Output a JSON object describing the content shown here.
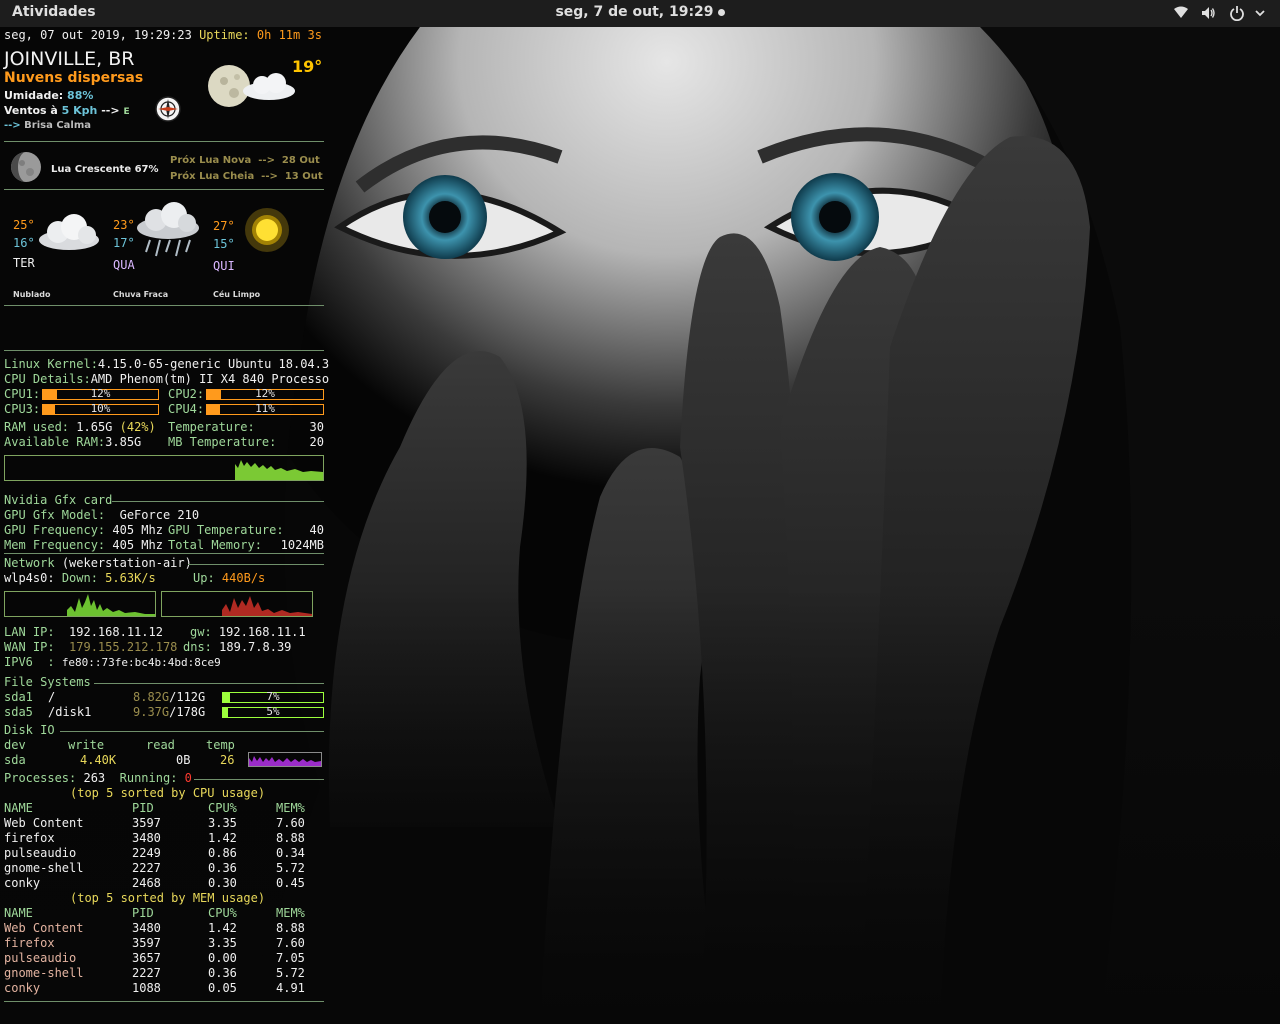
{
  "topbar": {
    "activities": "Atividades",
    "clock": "seg,  7 de out, 19:29",
    "icons": [
      "wifi-icon",
      "volume-icon",
      "power-icon",
      "chevron-down-icon"
    ]
  },
  "weather": {
    "datetime": "seg, 07 out 2019, 19:29:23",
    "uptime_label": "Uptime:",
    "uptime_value": "0h 11m 3s",
    "city": "JOINVILLE, BR",
    "condition": "Nuvens dispersas",
    "humidity_label": "Umidade:",
    "humidity_value": "88%",
    "wind_label": "Ventos à",
    "wind_value": "5 Kph",
    "wind_arrow": "-->",
    "wind_dir": "E",
    "breeze_arrow": "-->",
    "breeze": "Brisa Calma",
    "temp": "19°",
    "moon": "Lua Crescente 67%",
    "next_new_label": "Próx Lua Nova",
    "next_new_arrow": "-->",
    "next_new_date": "28 Out",
    "next_full_label": "Próx Lua Cheia",
    "next_full_arrow": "-->",
    "next_full_date": "13 Out",
    "forecast": [
      {
        "high": "25°",
        "low": "16°",
        "day": "TER",
        "desc": "Nublado",
        "icon": "cloudy-icon"
      },
      {
        "high": "23°",
        "low": "17°",
        "day": "QUA",
        "desc": "Chuva Fraca",
        "icon": "rain-icon"
      },
      {
        "high": "27°",
        "low": "15°",
        "day": "QUI",
        "desc": "Céu Limpo",
        "icon": "sun-icon"
      }
    ]
  },
  "system": {
    "kernel_label": "Linux Kernel:",
    "kernel_value": "4.15.0-65-generic Ubuntu 18.04.3",
    "cpu_label": "CPU Details:",
    "cpu_value": "AMD Phenom(tm) II X4 840 Processo",
    "cpus": [
      {
        "label": "CPU1:",
        "value": "12%",
        "pct": 12
      },
      {
        "label": "CPU2:",
        "value": "12%",
        "pct": 12
      },
      {
        "label": "CPU3:",
        "value": "10%",
        "pct": 10
      },
      {
        "label": "CPU4:",
        "value": "11%",
        "pct": 11
      }
    ],
    "ram_used_label": "RAM used:",
    "ram_used_value": "1.65G",
    "ram_used_pct": "(42%)",
    "ram_avail_label": "Available RAM:",
    "ram_avail_value": "3.85G",
    "temp_label": "Temperature:",
    "temp_value": "30",
    "mbtemp_label": "MB Temperature:",
    "mbtemp_value": "20"
  },
  "gpu": {
    "header": "Nvidia Gfx card",
    "model_label": "GPU Gfx Model:",
    "model_value": "GeForce 210",
    "freq_label": "GPU Frequency:",
    "freq_value": "405 Mhz",
    "gtemp_label": "GPU Temperature:",
    "gtemp_value": "40",
    "mem_label": "Mem Frequency:",
    "mem_value": "405 Mhz",
    "tmem_label": "Total Memory:",
    "tmem_value": "1024MB"
  },
  "network": {
    "header": "Network",
    "host": "(wekerstation-air)",
    "iface": "wlp4s0:",
    "down_label": "Down:",
    "down_value": "5.63K/s",
    "up_label": "Up:",
    "up_value": "440B/s",
    "lan_label": "LAN IP:",
    "lan_value": "192.168.11.12",
    "gw_label": "gw:",
    "gw_value": "192.168.11.1",
    "wan_label": "WAN IP:",
    "wan_value": "179.155.212.178",
    "dns_label": "dns:",
    "dns_value": "189.7.8.39",
    "ipv6_label": "IPV6  :",
    "ipv6_value": "fe80::73fe:bc4b:4bd:8ce9"
  },
  "fs": {
    "header": "File Systems",
    "items": [
      {
        "dev": "sda1",
        "mount": "/",
        "size": "8.82G",
        "total": "/112G",
        "pct_label": "7%",
        "pct": 7
      },
      {
        "dev": "sda5",
        "mount": "/disk1",
        "size": "9.37G",
        "total": "/178G",
        "pct_label": "5%",
        "pct": 5
      }
    ]
  },
  "diskio": {
    "header": "Disk IO",
    "cols": [
      "dev",
      "write",
      "read",
      "temp"
    ],
    "dev": "sda",
    "write": "4.40K",
    "read": "0B",
    "temp": "26"
  },
  "processes": {
    "label": "Processes:",
    "count": "263",
    "running_label": "Running:",
    "running": "0",
    "cpu_title": "(top 5 sorted by CPU usage)",
    "mem_title": "(top 5 sorted by MEM usage)",
    "cols": [
      "NAME",
      "PID",
      "CPU%",
      "MEM%"
    ],
    "cpu_rows": [
      [
        "Web Content",
        "3597",
        "3.35",
        "7.60"
      ],
      [
        "firefox",
        "3480",
        "1.42",
        "8.88"
      ],
      [
        "pulseaudio",
        "2249",
        "0.86",
        "0.34"
      ],
      [
        "gnome-shell",
        "2227",
        "0.36",
        "5.72"
      ],
      [
        "conky",
        "2468",
        "0.30",
        "0.45"
      ]
    ],
    "mem_rows": [
      [
        "Web Content",
        "3480",
        "1.42",
        "8.88"
      ],
      [
        "firefox",
        "3597",
        "3.35",
        "7.60"
      ],
      [
        "pulseaudio",
        "3657",
        "0.00",
        "7.05"
      ],
      [
        "gnome-shell",
        "2227",
        "0.36",
        "5.72"
      ],
      [
        "conky",
        "1088",
        "0.05",
        "4.91"
      ]
    ]
  }
}
